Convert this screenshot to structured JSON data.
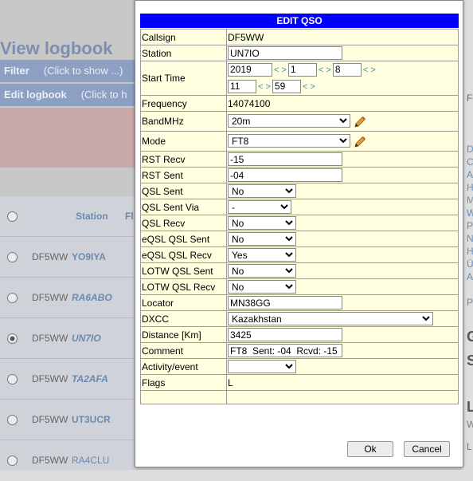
{
  "background": {
    "page_title": "View logbook",
    "filter_label": "Filter",
    "filter_hint": "(Click to show ...)",
    "edit_label": "Edit logbook",
    "edit_hint": "(Click to h",
    "station_header": "Station",
    "fl_header": "Fl",
    "rows": [
      {
        "call": "DF5WW",
        "station": "YO9IYA"
      },
      {
        "call": "DF5WW",
        "station": "RA6ABO"
      },
      {
        "call": "DF5WW",
        "station": "UN7IO"
      },
      {
        "call": "DF5WW",
        "station": "TA2AFA"
      },
      {
        "call": "DF5WW",
        "station": "UT3UCR"
      },
      {
        "call": "DF5WW",
        "station": "RA4CLU"
      }
    ],
    "right_letters": [
      "Fe",
      "D",
      "C",
      "A",
      "H",
      "M",
      "W",
      "P",
      "N",
      "H",
      "Ü",
      "A",
      "Pr",
      "G",
      "S",
      "L",
      "W",
      "L"
    ]
  },
  "modal": {
    "title": "EDIT QSO",
    "fields": {
      "callsign_label": "Callsign",
      "callsign_value": "DF5WW",
      "station_label": "Station",
      "station_value": "UN7IO",
      "start_time_label": "Start Time",
      "year": "2019",
      "month": "1",
      "day": "8",
      "hour": "11",
      "minute": "59",
      "arrows": "< >",
      "frequency_label": "Frequency",
      "frequency_value": "14074100",
      "band_label": "BandMHz",
      "band_value": "20m",
      "mode_label": "Mode",
      "mode_value": "FT8",
      "rst_recv_label": "RST Recv",
      "rst_recv_value": "-15",
      "rst_sent_label": "RST Sent",
      "rst_sent_value": "-04",
      "qsl_sent_label": "QSL Sent",
      "qsl_sent_value": "No",
      "qsl_sent_via_label": "QSL Sent Via",
      "qsl_sent_via_value": "-",
      "qsl_recv_label": "QSL Recv",
      "qsl_recv_value": "No",
      "eqsl_sent_label": "eQSL QSL Sent",
      "eqsl_sent_value": "No",
      "eqsl_recv_label": "eQSL QSL Recv",
      "eqsl_recv_value": "Yes",
      "lotw_sent_label": "LOTW QSL Sent",
      "lotw_sent_value": "No",
      "lotw_recv_label": "LOTW QSL Recv",
      "lotw_recv_value": "No",
      "locator_label": "Locator",
      "locator_value": "MN38GG",
      "dxcc_label": "DXCC",
      "dxcc_value": "Kazakhstan",
      "distance_label": "Distance [Km]",
      "distance_value": "3425",
      "comment_label": "Comment",
      "comment_value": "FT8  Sent: -04  Rcvd: -15",
      "activity_label": "Activity/event",
      "activity_value": "",
      "flags_label": "Flags",
      "flags_value": "L"
    },
    "ok_label": "Ok",
    "cancel_label": "Cancel"
  },
  "colors": {
    "header_blue": "#0000ff",
    "form_bg": "#ffffe0",
    "link_teal": "#3b8fa3"
  }
}
